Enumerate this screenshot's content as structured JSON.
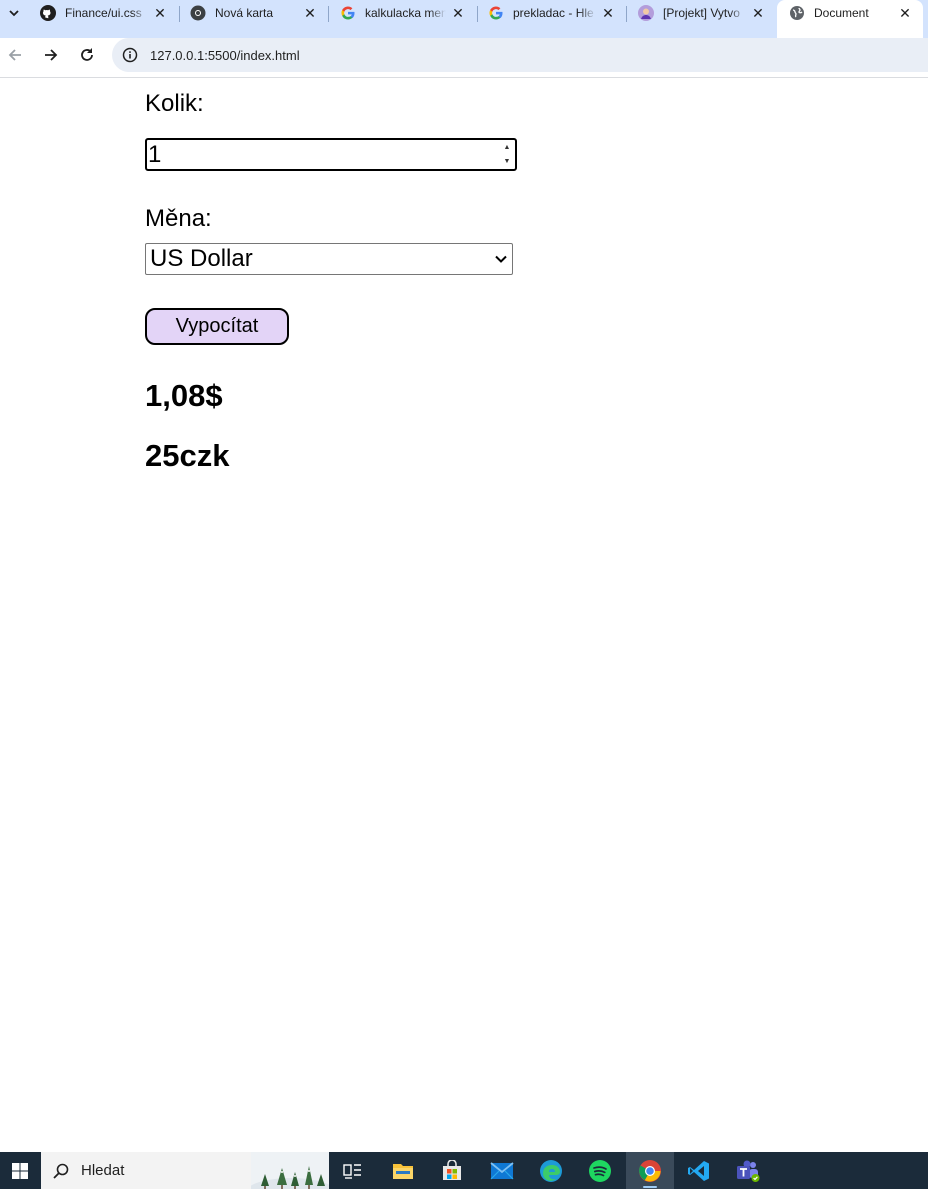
{
  "browser": {
    "tabs": [
      {
        "title": "Finance/ui.css",
        "icon": "github-icon",
        "active": false
      },
      {
        "title": "Nová karta",
        "icon": "chrome-icon",
        "active": false
      },
      {
        "title": "kalkulacka men",
        "icon": "google-icon",
        "active": false
      },
      {
        "title": "prekladac - Hle",
        "icon": "google-icon",
        "active": false
      },
      {
        "title": "[Projekt] Vytvo",
        "icon": "avatar-icon",
        "active": false
      },
      {
        "title": "Document",
        "icon": "globe-icon",
        "active": true
      }
    ],
    "url": "127.0.0.1:5500/index.html"
  },
  "form": {
    "amount_label": "Kolik:",
    "amount_value": "1",
    "currency_label": "Měna:",
    "currency_selected": "US Dollar",
    "calculate_label": "Vypocítat"
  },
  "results": {
    "converted": "1,08$",
    "czk": "25czk"
  },
  "taskbar": {
    "search_placeholder": "Hledat",
    "apps": [
      "task-view-icon",
      "file-explorer-icon",
      "microsoft-store-icon",
      "mail-icon",
      "edge-icon",
      "spotify-icon",
      "chrome-icon",
      "vscode-icon",
      "teams-icon"
    ],
    "active_app": "chrome-icon"
  },
  "colors": {
    "tabstrip": "#d3e3fd",
    "button_bg": "#e3d4f7",
    "taskbar": "#1b2b3a"
  }
}
